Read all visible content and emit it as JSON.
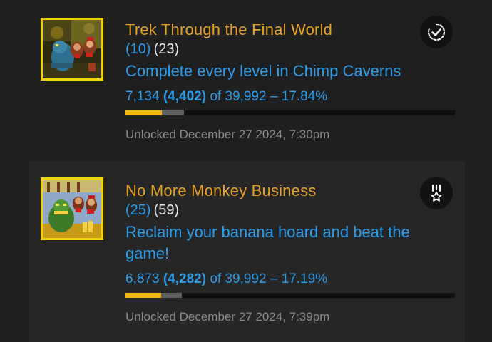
{
  "achievements": [
    {
      "title": "Trek Through the Final World",
      "points": "(10)",
      "retro_points": "(23)",
      "description": "Complete every level in Chimp Caverns",
      "stats_hardcore": "7,134",
      "stats_softcore": "(4,402)",
      "stats_total": "of 39,992 – 17.84%",
      "progress_hardcore_fraction": 0.1099,
      "progress_softcore_fraction": 0.0685,
      "unlocked": "Unlocked December 27 2024, 7:30pm",
      "type_icon": "progression-check-icon"
    },
    {
      "title": "No More Monkey Business",
      "points": "(25)",
      "retro_points": "(59)",
      "description": "Reclaim your banana hoard and beat the game!",
      "stats_hardcore": "6,873",
      "stats_softcore": "(4,282)",
      "stats_total": "of 39,992 – 17.19%",
      "progress_hardcore_fraction": 0.1072,
      "progress_softcore_fraction": 0.0647,
      "unlocked": "Unlocked December 27 2024, 7:39pm",
      "type_icon": "win-condition-medal-icon"
    }
  ],
  "colors": {
    "title": "#e7a122",
    "link_blue": "#2b9ce8",
    "badge_border": "#f0d300",
    "progress_hardcore": "#f0b613",
    "progress_softcore": "#5f5f5f"
  }
}
